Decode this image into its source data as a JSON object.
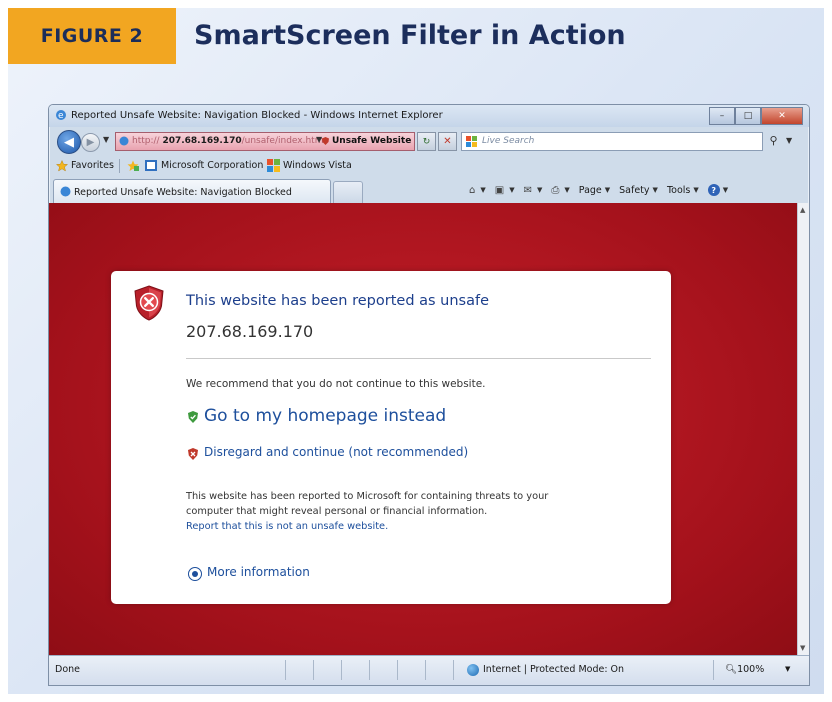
{
  "figure": {
    "badge": "FIGURE 2",
    "title": "SmartScreen Filter in Action",
    "badge_color": "#f2a621",
    "title_color": "#1c2e5c"
  },
  "window": {
    "title": "Reported Unsafe Website: Navigation Blocked - Windows Internet Explorer",
    "controls": {
      "minimize": "–",
      "maximize": "□",
      "close": "✕"
    }
  },
  "addressbar": {
    "url_prefix": "http://",
    "url_host": "207.68.169.170",
    "url_path": "/unsafe/index.htm",
    "status_label": "Unsafe Website",
    "search_placeholder": "Live Search",
    "unsafe_color": "#e9a3b0"
  },
  "favorites": {
    "label": "Favorites",
    "items": [
      "Microsoft Corporation",
      "Windows Vista"
    ]
  },
  "tabs": {
    "active_tab": "Reported Unsafe Website: Navigation Blocked"
  },
  "commandbar": {
    "page": "Page",
    "safety": "Safety",
    "tools": "Tools"
  },
  "warning": {
    "title": "This website has been reported as unsafe",
    "address": "207.68.169.170",
    "recommendation": "We recommend that you do not continue to this website.",
    "homepage_link": "Go to my homepage instead",
    "continue_link": "Disregard and continue (not recommended)",
    "description_line1": "This website has been reported to Microsoft for containing threats to your",
    "description_line2": "computer that might reveal personal or financial information.",
    "report_link": "Report that this is not an unsafe website.",
    "more_info": "More information",
    "background_color": "#b5141e",
    "link_color": "#1d4f9c"
  },
  "statusbar": {
    "status": "Done",
    "zone": "Internet | Protected Mode: On",
    "zoom": "100%"
  }
}
